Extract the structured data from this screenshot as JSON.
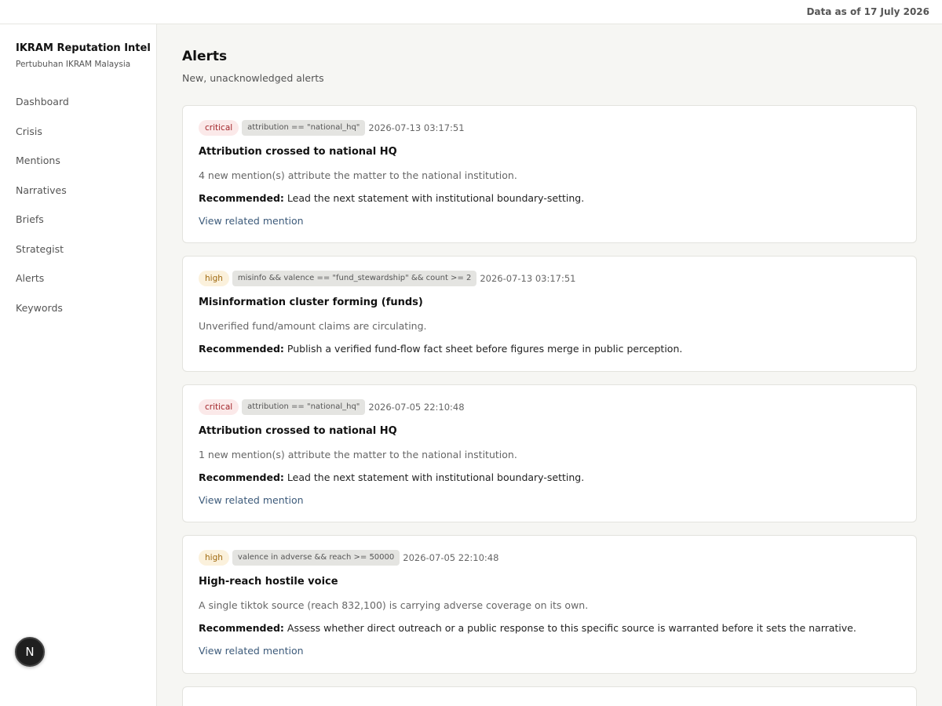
{
  "header": {
    "data_as_of": "Data as of 17 July 2026"
  },
  "sidebar": {
    "title": "IKRAM Reputation Intel",
    "subtitle": "Pertubuhan IKRAM Malaysia",
    "items": [
      {
        "label": "Dashboard"
      },
      {
        "label": "Crisis"
      },
      {
        "label": "Mentions"
      },
      {
        "label": "Narratives"
      },
      {
        "label": "Briefs"
      },
      {
        "label": "Strategist"
      },
      {
        "label": "Alerts"
      },
      {
        "label": "Keywords"
      }
    ],
    "badge_letter": "N"
  },
  "main": {
    "title": "Alerts",
    "subtitle": "New, unacknowledged alerts",
    "recommended_label": "Recommended:",
    "alerts": [
      {
        "severity": "critical",
        "rule": "attribution == \"national_hq\"",
        "timestamp": "2026-07-13 03:17:51",
        "title": "Attribution crossed to national HQ",
        "description": "4 new mention(s) attribute the matter to the national institution.",
        "recommendation": "Lead the next statement with institutional boundary-setting.",
        "link": "View related mention"
      },
      {
        "severity": "high",
        "rule": "misinfo && valence == \"fund_stewardship\" && count >= 2",
        "timestamp": "2026-07-13 03:17:51",
        "title": "Misinformation cluster forming (funds)",
        "description": "Unverified fund/amount claims are circulating.",
        "recommendation": "Publish a verified fund-flow fact sheet before figures merge in public perception.",
        "link": ""
      },
      {
        "severity": "critical",
        "rule": "attribution == \"national_hq\"",
        "timestamp": "2026-07-05 22:10:48",
        "title": "Attribution crossed to national HQ",
        "description": "1 new mention(s) attribute the matter to the national institution.",
        "recommendation": "Lead the next statement with institutional boundary-setting.",
        "link": "View related mention"
      },
      {
        "severity": "high",
        "rule": "valence in adverse && reach >= 50000",
        "timestamp": "2026-07-05 22:10:48",
        "title": "High-reach hostile voice",
        "description": "A single tiktok source (reach 832,100) is carrying adverse coverage on its own.",
        "recommendation": "Assess whether direct outreach or a public response to this specific source is warranted before it sets the narrative.",
        "link": "View related mention"
      }
    ]
  }
}
